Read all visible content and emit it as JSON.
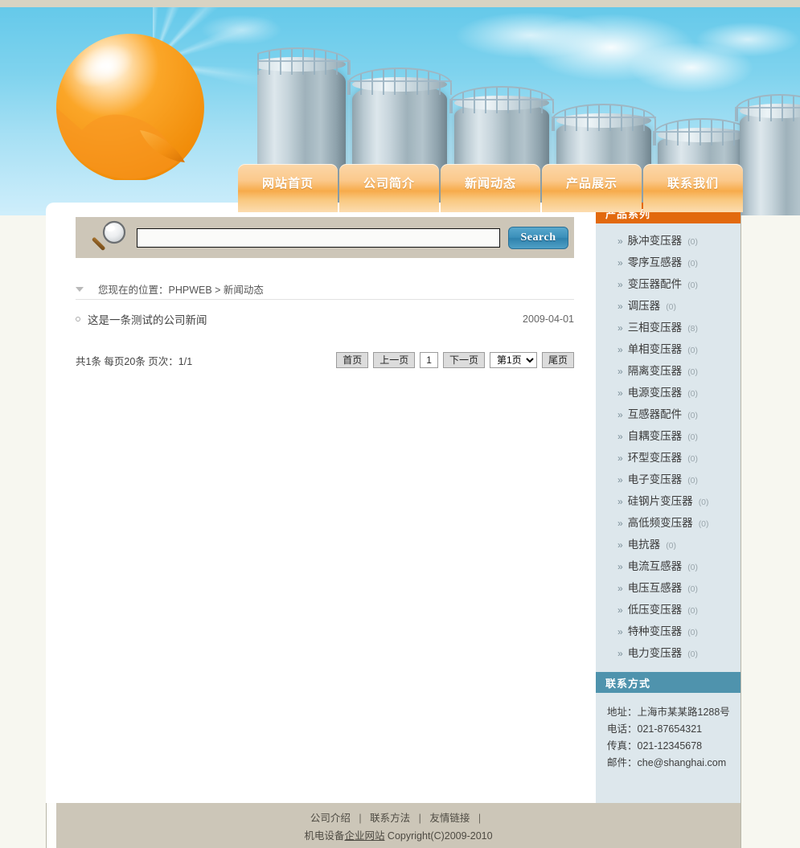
{
  "nav": {
    "items": [
      {
        "label": "网站首页",
        "name": "nav-home"
      },
      {
        "label": "公司简介",
        "name": "nav-about"
      },
      {
        "label": "新闻动态",
        "name": "nav-news"
      },
      {
        "label": "产品展示",
        "name": "nav-products"
      },
      {
        "label": "联系我们",
        "name": "nav-contact"
      }
    ]
  },
  "search": {
    "value": "",
    "placeholder": "",
    "button_label": "Search",
    "icon": "magnifier-icon"
  },
  "breadcrumb": {
    "text": "您现在的位置：PHPWEB > 新闻动态",
    "toggle_icon": "triangle-down-icon"
  },
  "news": {
    "items": [
      {
        "title": "这是一条测试的公司新闻",
        "date": "2009-04-01"
      }
    ]
  },
  "pagination": {
    "summary": "共1条 每页20条 页次：1/1",
    "first_label": "首页",
    "prev_label": "上一页",
    "current_label": "1",
    "next_label": "下一页",
    "select_value": "第1页",
    "select_options": [
      "第1页"
    ],
    "last_label": "尾页"
  },
  "sidebar": {
    "products_title": "产品系列",
    "categories": [
      {
        "label": "脉冲变压器",
        "count": "(0)"
      },
      {
        "label": "零序互感器",
        "count": "(0)"
      },
      {
        "label": "变压器配件",
        "count": "(0)"
      },
      {
        "label": "调压器",
        "count": "(0)"
      },
      {
        "label": "三相变压器",
        "count": "(8)"
      },
      {
        "label": "单相变压器",
        "count": "(0)"
      },
      {
        "label": "隔离变压器",
        "count": "(0)"
      },
      {
        "label": "电源变压器",
        "count": "(0)"
      },
      {
        "label": "互感器配件",
        "count": "(0)"
      },
      {
        "label": "自耦变压器",
        "count": "(0)"
      },
      {
        "label": "环型变压器",
        "count": "(0)"
      },
      {
        "label": "电子变压器",
        "count": "(0)"
      },
      {
        "label": "硅钢片变压器",
        "count": "(0)"
      },
      {
        "label": "高低频变压器",
        "count": "(0)"
      },
      {
        "label": "电抗器",
        "count": "(0)"
      },
      {
        "label": "电流互感器",
        "count": "(0)"
      },
      {
        "label": "电压互感器",
        "count": "(0)"
      },
      {
        "label": "低压变压器",
        "count": "(0)"
      },
      {
        "label": "特种变压器",
        "count": "(0)"
      },
      {
        "label": "电力变压器",
        "count": "(0)"
      }
    ],
    "contact_title": "联系方式",
    "contact_lines": [
      "地址：上海市某某路1288号",
      "电话：021-87654321",
      "传真：021-12345678",
      "邮件：che@shanghai.com"
    ]
  },
  "footer": {
    "links": [
      "公司介绍",
      "联系方法",
      "友情链接"
    ],
    "separator": "|",
    "copyright_prefix": "机电设备",
    "copyright_underlined": "企业网站",
    "copyright_suffix": " Copyright(C)2009-2010"
  },
  "colors": {
    "accent_orange": "#e2690e",
    "accent_teal": "#4f93ad",
    "nav_orange": "#f7ab4b",
    "sidebar_bg": "#dde7ec",
    "page_bg": "#f7f7f0",
    "footer_bg": "#ccc6b8",
    "search_bar_bg": "#cdc6b8",
    "search_button_blue": "#3a8fba"
  }
}
